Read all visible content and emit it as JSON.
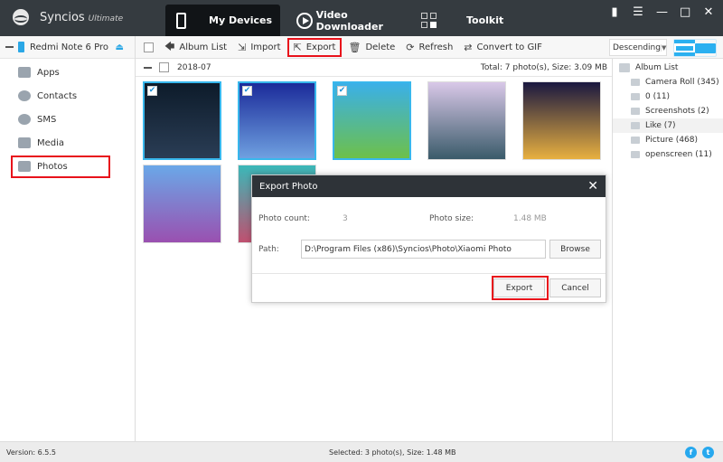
{
  "app": {
    "name": "Syncios",
    "edition": "Ultimate"
  },
  "nav_tabs": [
    {
      "label": "My Devices",
      "icon": "phone-icon",
      "active": true
    },
    {
      "label": "Video Downloader",
      "icon": "play-icon",
      "active": false
    },
    {
      "label": "Toolkit",
      "icon": "grid-icon",
      "active": false
    }
  ],
  "window_buttons": {
    "feedback": "feedback-icon",
    "menu": "menu-icon",
    "minimize": "minimize-icon",
    "maximize": "maximize-icon",
    "close": "close-icon"
  },
  "device": {
    "name": "Redmi Note 6 Pro"
  },
  "sidebar": {
    "items": [
      {
        "label": "Apps",
        "icon": "apps-icon"
      },
      {
        "label": "Contacts",
        "icon": "contacts-icon"
      },
      {
        "label": "SMS",
        "icon": "sms-icon"
      },
      {
        "label": "Media",
        "icon": "media-icon"
      },
      {
        "label": "Photos",
        "icon": "photos-icon",
        "active": true
      }
    ]
  },
  "toolbar": {
    "album_list": "Album List",
    "import": "Import",
    "export": "Export",
    "delete": "Delete",
    "refresh": "Refresh",
    "convert_gif": "Convert to GIF",
    "sort": "Descending"
  },
  "group": {
    "date": "2018-07",
    "total": "Total: 7 photo(s), Size: 3.09 MB"
  },
  "photos": [
    {
      "name": "plum-blossom",
      "selected": true,
      "colors": [
        "#0d1b2a",
        "#2a3d55"
      ]
    },
    {
      "name": "blue-planet",
      "selected": true,
      "colors": [
        "#1b2b9a",
        "#6fa0e0"
      ]
    },
    {
      "name": "dandelion",
      "selected": true,
      "colors": [
        "#3ab0e8",
        "#6dc04a"
      ]
    },
    {
      "name": "mountain-warrior",
      "selected": false,
      "colors": [
        "#d9c8e8",
        "#3a5b6a"
      ]
    },
    {
      "name": "halloween",
      "selected": false,
      "colors": [
        "#1a1840",
        "#e8b040"
      ]
    },
    {
      "name": "tulip-field",
      "selected": false,
      "colors": [
        "#6aa8e8",
        "#9a50b0"
      ]
    },
    {
      "name": "teal-sunset",
      "selected": false,
      "colors": [
        "#3ab8b8",
        "#c05070"
      ]
    }
  ],
  "albums": {
    "header": "Album List",
    "items": [
      {
        "label": "Camera Roll (345)",
        "icon": "camera-icon"
      },
      {
        "label": "0 (11)",
        "icon": "image-icon"
      },
      {
        "label": "Screenshots (2)",
        "icon": "image-icon"
      },
      {
        "label": "Like (7)",
        "icon": "image-icon",
        "active": true
      },
      {
        "label": "Picture (468)",
        "icon": "image-icon"
      },
      {
        "label": "openscreen (11)",
        "icon": "image-icon"
      }
    ]
  },
  "dialog": {
    "title": "Export Photo",
    "count_label": "Photo count:",
    "count_value": "3",
    "size_label": "Photo size:",
    "size_value": "1.48 MB",
    "path_label": "Path:",
    "path_value": "D:\\Program Files (x86)\\Syncios\\Photo\\Xiaomi Photo",
    "browse": "Browse",
    "export": "Export",
    "cancel": "Cancel"
  },
  "status": {
    "version": "Version: 6.5.5",
    "selection": "Selected: 3 photo(s), Size: 1.48 MB"
  },
  "colors": {
    "accent": "#2bb0f0",
    "highlight": "#e8121b",
    "titlebar": "#353b40"
  }
}
